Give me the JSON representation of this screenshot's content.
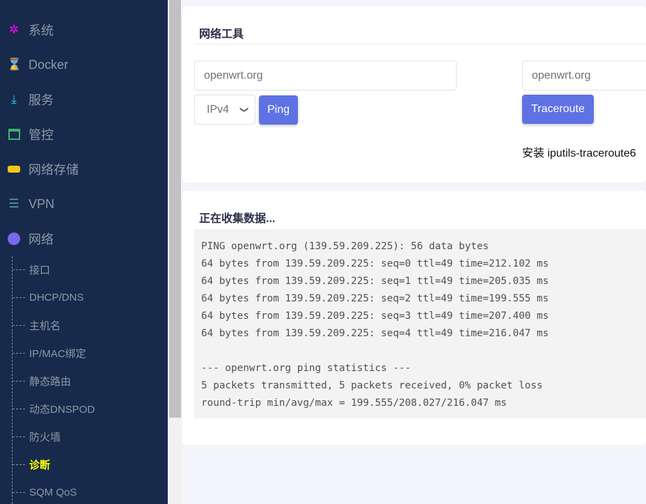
{
  "sidebar": {
    "items": [
      {
        "label": "系统",
        "icon": "gears-icon",
        "color": "#ff00ff"
      },
      {
        "label": "Docker",
        "icon": "hourglass-icon",
        "color": "#52c41a"
      },
      {
        "label": "服务",
        "icon": "download-icon",
        "color": "#1ec8f0"
      },
      {
        "label": "管控",
        "icon": "calendar-icon",
        "color": "#3cb371"
      },
      {
        "label": "网络存储",
        "icon": "hdd-icon",
        "color": "#f5c518"
      },
      {
        "label": "VPN",
        "icon": "list-icon",
        "color": "#5f9ea0"
      },
      {
        "label": "网络",
        "icon": "globe-icon",
        "color": "#7b68ee"
      }
    ],
    "subitems": [
      "接口",
      "DHCP/DNS",
      "主机名",
      "IP/MAC绑定",
      "静态路由",
      "动态DNSPOD",
      "防火墙",
      "诊断",
      "SQM QoS"
    ],
    "active": "诊断"
  },
  "tools": {
    "title": "网络工具",
    "ping_host": "openwrt.org",
    "ip_version": "IPv4",
    "ping_label": "Ping",
    "trace_host": "openwrt.org",
    "trace_label": "Traceroute",
    "note": "安装 iputils-traceroute6"
  },
  "output": {
    "title": "正在收集数据...",
    "text": "PING openwrt.org (139.59.209.225): 56 data bytes\n64 bytes from 139.59.209.225: seq=0 ttl=49 time=212.102 ms\n64 bytes from 139.59.209.225: seq=1 ttl=49 time=205.035 ms\n64 bytes from 139.59.209.225: seq=2 ttl=49 time=199.555 ms\n64 bytes from 139.59.209.225: seq=3 ttl=49 time=207.400 ms\n64 bytes from 139.59.209.225: seq=4 ttl=49 time=216.047 ms\n\n--- openwrt.org ping statistics ---\n5 packets transmitted, 5 packets received, 0% packet loss\nround-trip min/avg/max = 199.555/208.027/216.047 ms"
  }
}
